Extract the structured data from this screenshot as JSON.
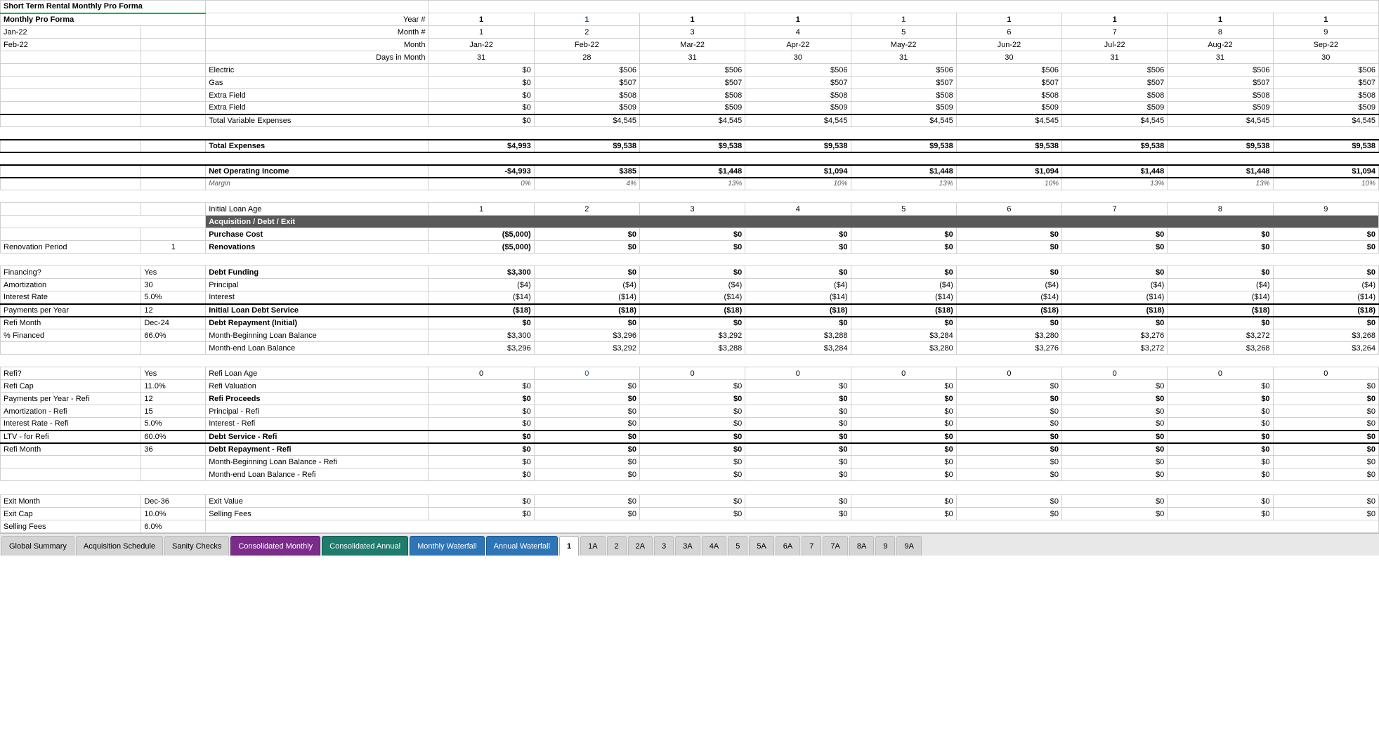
{
  "title": "Short Term Rental Monthly Pro Forma",
  "labels": {
    "left_col1": [
      "",
      "",
      "Jan-22",
      "Feb-22",
      "",
      "",
      "",
      "",
      "",
      "",
      "",
      "",
      "",
      "",
      "",
      "",
      "",
      "",
      "",
      "",
      "",
      "",
      "",
      "",
      "",
      "",
      "",
      "",
      "Renovation Period",
      "",
      "Financing?",
      "Amortization",
      "Interest Rate",
      "Payments per Year",
      "Refi Month",
      "% Financed",
      "",
      "",
      "Refi?",
      "Refi Cap",
      "Payments per Year - Refi",
      "Amortization - Refi",
      "Interest Rate - Refi",
      "LTV - for Refi",
      "Refi Month",
      "",
      "",
      "",
      "",
      "",
      "Exit Month",
      "Exit Cap",
      "Selling Fees"
    ],
    "left_col2": [
      "",
      "",
      "",
      "",
      "",
      "",
      "",
      "",
      "",
      "",
      "",
      "",
      "",
      "",
      "",
      "",
      "",
      "",
      "",
      "",
      "",
      "",
      "",
      "",
      "",
      "",
      "",
      "",
      "1",
      "",
      "Yes",
      "30",
      "5.0%",
      "12",
      "Dec-24",
      "66.0%",
      "",
      "",
      "Yes",
      "11.0%",
      "12",
      "15",
      "5.0%",
      "60.0%",
      "36",
      "",
      "",
      "",
      "",
      "",
      "Dec-36",
      "10.0%",
      "6.0%"
    ]
  },
  "header_row": {
    "year_label": "Year #",
    "month_label": "Month #",
    "month_name": "Month",
    "days": "Days in Month"
  },
  "columns": [
    {
      "year": "1",
      "month": "1",
      "name": "Jan-22",
      "days": "31"
    },
    {
      "year": "1",
      "month": "2",
      "name": "Feb-22",
      "days": "28"
    },
    {
      "year": "1",
      "month": "3",
      "name": "Mar-22",
      "days": "31"
    },
    {
      "year": "1",
      "month": "4",
      "name": "Apr-22",
      "days": "30"
    },
    {
      "year": "1",
      "month": "5",
      "name": "May-22",
      "days": "31"
    },
    {
      "year": "1",
      "month": "6",
      "name": "Jun-22",
      "days": "30"
    },
    {
      "year": "1",
      "month": "7",
      "name": "Jul-22",
      "days": "31"
    },
    {
      "year": "1",
      "month": "8",
      "name": "Aug-22",
      "days": "31"
    },
    {
      "year": "1",
      "month": "9",
      "name": "Sep-22",
      "days": "30"
    }
  ],
  "rows": {
    "electric": [
      "$0",
      "$506",
      "$506",
      "$506",
      "$506",
      "$506",
      "$506",
      "$506",
      "$506"
    ],
    "gas": [
      "$0",
      "$507",
      "$507",
      "$507",
      "$507",
      "$507",
      "$507",
      "$507",
      "$507"
    ],
    "extra_field1": [
      "$0",
      "$508",
      "$508",
      "$508",
      "$508",
      "$508",
      "$508",
      "$508",
      "$508"
    ],
    "extra_field2": [
      "$0",
      "$509",
      "$509",
      "$509",
      "$509",
      "$509",
      "$509",
      "$509",
      "$509"
    ],
    "total_variable": [
      "$0",
      "$4,545",
      "$4,545",
      "$4,545",
      "$4,545",
      "$4,545",
      "$4,545",
      "$4,545",
      "$4,545"
    ],
    "total_expenses": [
      "$4,993",
      "$9,538",
      "$9,538",
      "$9,538",
      "$9,538",
      "$9,538",
      "$9,538",
      "$9,538",
      "$9,538"
    ],
    "net_operating_income": [
      "-$4,993",
      "$385",
      "$1,448",
      "$1,094",
      "$1,448",
      "$1,094",
      "$1,448",
      "$1,448",
      "$1,094"
    ],
    "margin": [
      "0%",
      "4%",
      "13%",
      "10%",
      "13%",
      "10%",
      "13%",
      "13%",
      "10%"
    ],
    "initial_loan_age": [
      "1",
      "2",
      "3",
      "4",
      "5",
      "6",
      "7",
      "8",
      "9"
    ],
    "purchase_cost": [
      "($5,000)",
      "$0",
      "$0",
      "$0",
      "$0",
      "$0",
      "$0",
      "$0",
      "$0"
    ],
    "renovations": [
      "($5,000)",
      "$0",
      "$0",
      "$0",
      "$0",
      "$0",
      "$0",
      "$0",
      "$0"
    ],
    "debt_funding": [
      "$3,300",
      "$0",
      "$0",
      "$0",
      "$0",
      "$0",
      "$0",
      "$0",
      "$0"
    ],
    "principal": [
      "($4)",
      "($4)",
      "($4)",
      "($4)",
      "($4)",
      "($4)",
      "($4)",
      "($4)",
      "($4)"
    ],
    "interest": [
      "($14)",
      "($14)",
      "($14)",
      "($14)",
      "($14)",
      "($14)",
      "($14)",
      "($14)",
      "($14)"
    ],
    "initial_loan_debt_service": [
      "($18)",
      "($18)",
      "($18)",
      "($18)",
      "($18)",
      "($18)",
      "($18)",
      "($18)",
      "($18)"
    ],
    "debt_repayment_initial": [
      "$0",
      "$0",
      "$0",
      "$0",
      "$0",
      "$0",
      "$0",
      "$0",
      "$0"
    ],
    "month_beg_loan_balance": [
      "$3,300",
      "$3,296",
      "$3,292",
      "$3,288",
      "$3,284",
      "$3,280",
      "$3,276",
      "$3,272",
      "$3,268"
    ],
    "month_end_loan_balance": [
      "$3,296",
      "$3,292",
      "$3,288",
      "$3,284",
      "$3,280",
      "$3,276",
      "$3,272",
      "$3,268",
      "$3,264"
    ],
    "refi_loan_age": [
      "0",
      "0",
      "0",
      "0",
      "0",
      "0",
      "0",
      "0",
      "0"
    ],
    "refi_valuation": [
      "$0",
      "$0",
      "$0",
      "$0",
      "$0",
      "$0",
      "$0",
      "$0",
      "$0"
    ],
    "refi_proceeds": [
      "$0",
      "$0",
      "$0",
      "$0",
      "$0",
      "$0",
      "$0",
      "$0",
      "$0"
    ],
    "principal_refi": [
      "$0",
      "$0",
      "$0",
      "$0",
      "$0",
      "$0",
      "$0",
      "$0",
      "$0"
    ],
    "interest_refi": [
      "$0",
      "$0",
      "$0",
      "$0",
      "$0",
      "$0",
      "$0",
      "$0",
      "$0"
    ],
    "debt_service_refi": [
      "$0",
      "$0",
      "$0",
      "$0",
      "$0",
      "$0",
      "$0",
      "$0",
      "$0"
    ],
    "debt_repayment_refi": [
      "$0",
      "$0",
      "$0",
      "$0",
      "$0",
      "$0",
      "$0",
      "$0",
      "$0"
    ],
    "month_beg_loan_balance_refi": [
      "$0",
      "$0",
      "$0",
      "$0",
      "$0",
      "$0",
      "$0",
      "$0",
      "$0"
    ],
    "month_end_loan_balance_refi": [
      "$0",
      "$0",
      "$0",
      "$0",
      "$0",
      "$0",
      "$0",
      "$0",
      "$0"
    ],
    "exit_value": [
      "$0",
      "$0",
      "$0",
      "$0",
      "$0",
      "$0",
      "$0",
      "$0",
      "$0"
    ],
    "selling_fees": [
      "$0",
      "$0",
      "$0",
      "$0",
      "$0",
      "$0",
      "$0",
      "$0",
      "$0"
    ]
  },
  "tabs": [
    {
      "label": "Global Summary",
      "type": "default"
    },
    {
      "label": "Acquisition Schedule",
      "type": "default"
    },
    {
      "label": "Sanity Checks",
      "type": "default"
    },
    {
      "label": "Consolidated Monthly",
      "type": "purple"
    },
    {
      "label": "Consolidated Annual",
      "type": "teal"
    },
    {
      "label": "Monthly Waterfall",
      "type": "blue-tab"
    },
    {
      "label": "Annual Waterfall",
      "type": "blue-tab"
    },
    {
      "label": "1",
      "type": "number-tab",
      "active": true
    },
    {
      "label": "1A",
      "type": "number-tab"
    },
    {
      "label": "2",
      "type": "number-tab"
    },
    {
      "label": "2A",
      "type": "number-tab"
    },
    {
      "label": "3",
      "type": "number-tab"
    },
    {
      "label": "3A",
      "type": "number-tab"
    },
    {
      "label": "4A",
      "type": "number-tab"
    },
    {
      "label": "5",
      "type": "number-tab"
    },
    {
      "label": "5A",
      "type": "number-tab"
    },
    {
      "label": "6A",
      "type": "number-tab"
    },
    {
      "label": "7",
      "type": "number-tab"
    },
    {
      "label": "7A",
      "type": "number-tab"
    },
    {
      "label": "8A",
      "type": "number-tab"
    },
    {
      "label": "9",
      "type": "number-tab"
    },
    {
      "label": "9A",
      "type": "number-tab"
    }
  ]
}
